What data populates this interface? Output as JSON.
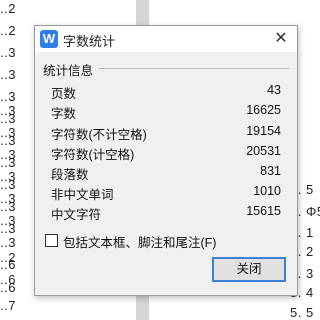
{
  "background": {
    "left_numbers": [
      "..2",
      "..2",
      "..3",
      "..3",
      "..3",
      "..3",
      "..3",
      "..3",
      "..3",
      "..3",
      "..3",
      "..3",
      "..3",
      "..3",
      "..3",
      "..3",
      "..3",
      "..3",
      "..2",
      "..6",
      "..6",
      "..6",
      "..7"
    ],
    "right_numbers": [
      "5. 5",
      "5. Φ5",
      "5. 1",
      "5. 2",
      "5. 3",
      "5. 4",
      "5. 5"
    ]
  },
  "dialog": {
    "title": "字数统计",
    "app_icon": "W",
    "close_icon": "✕",
    "group_label": "统计信息",
    "stats": [
      {
        "label": "页数",
        "value": "43"
      },
      {
        "label": "字数",
        "value": "16625"
      },
      {
        "label": "字符数(不计空格)",
        "value": "19154"
      },
      {
        "label": "字符数(计空格)",
        "value": "20531"
      },
      {
        "label": "段落数",
        "value": "831"
      },
      {
        "label": "非中文单词",
        "value": "1010"
      },
      {
        "label": "中文字符",
        "value": "15615"
      }
    ],
    "checkbox_label": "包括文本框、脚注和尾注(F)",
    "checkbox_checked": false,
    "close_button_label": "关闭",
    "accent_color": "#3f7fd6",
    "icon_color": "#2f7fe8"
  }
}
